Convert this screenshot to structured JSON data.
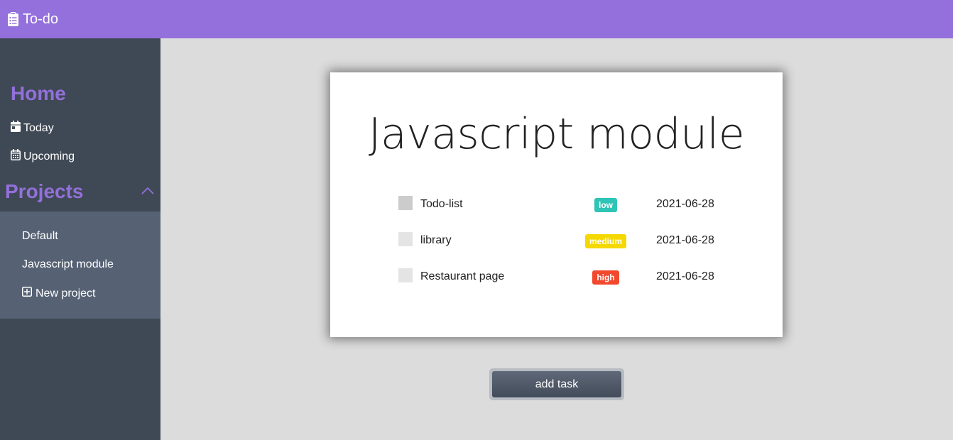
{
  "app": {
    "title": "To-do",
    "icon": "clipboard-list-icon"
  },
  "colors": {
    "brand": "#9370db",
    "sidebar": "#3f4955",
    "panel": "#566274",
    "background": "#dcdcdc"
  },
  "sidebar": {
    "home_heading": "Home",
    "nav": [
      {
        "label": "Today",
        "icon": "calendar-day-icon"
      },
      {
        "label": "Upcoming",
        "icon": "calendar-week-icon"
      }
    ],
    "projects_heading": "Projects",
    "projects_toggle_icon": "chevron-up-icon",
    "projects": [
      {
        "label": "Default"
      },
      {
        "label": "Javascript module"
      }
    ],
    "new_project": {
      "label": "New project",
      "icon": "plus-square-icon"
    }
  },
  "main": {
    "project_title": "Javascript module",
    "tasks": [
      {
        "name": "Todo-list",
        "priority": "low",
        "priority_color": "#2ec4b6",
        "date": "2021-06-28",
        "checkbox_color": "#cccccc"
      },
      {
        "name": "library",
        "priority": "medium",
        "priority_color": "#f5d800",
        "date": "2021-06-28",
        "checkbox_color": "#e4e4e4"
      },
      {
        "name": "Restaurant page",
        "priority": "high",
        "priority_color": "#f2492e",
        "date": "2021-06-28",
        "checkbox_color": "#e4e4e4"
      }
    ],
    "add_task_label": "add task"
  }
}
